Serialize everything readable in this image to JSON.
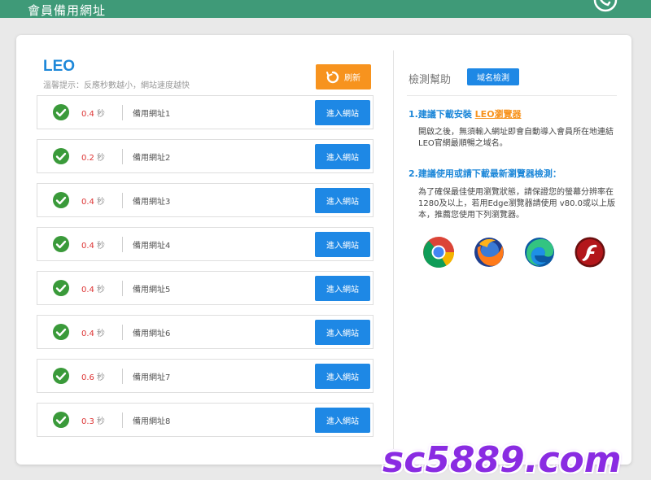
{
  "topbar": {
    "title": "會員備用網址"
  },
  "left": {
    "brand": "LEO",
    "hint": "溫馨提示：反應秒數越小，網站速度越快",
    "refresh_label": "刷新",
    "sites": [
      {
        "speed": "0.4",
        "unit": "秒",
        "name": "備用網址1",
        "button": "進入網站"
      },
      {
        "speed": "0.2",
        "unit": "秒",
        "name": "備用網址2",
        "button": "進入網站"
      },
      {
        "speed": "0.4",
        "unit": "秒",
        "name": "備用網址3",
        "button": "進入網站"
      },
      {
        "speed": "0.4",
        "unit": "秒",
        "name": "備用網址4",
        "button": "進入網站"
      },
      {
        "speed": "0.4",
        "unit": "秒",
        "name": "備用網址5",
        "button": "進入網站"
      },
      {
        "speed": "0.4",
        "unit": "秒",
        "name": "備用網址6",
        "button": "進入網站"
      },
      {
        "speed": "0.6",
        "unit": "秒",
        "name": "備用網址7",
        "button": "進入網站"
      },
      {
        "speed": "0.3",
        "unit": "秒",
        "name": "備用網址8",
        "button": "進入網站"
      }
    ]
  },
  "right": {
    "title": "檢測幫助",
    "domain_button": "域名檢測",
    "section1_prefix": "1.建議下載安裝 ",
    "section1_link": "LEO瀏覽器",
    "section1_text": "開啟之後，無須輸入網址即會自動導入會員所在地連結LEO官網最順暢之域名。",
    "section2_head": "2.建議使用或請下載最新瀏覽器檢測：",
    "section2_text": "為了確保最佳使用瀏覽狀態，請保證您的螢幕分辨率在1280及以上，若用Edge瀏覽器請使用 v80.0或以上版本，推薦您使用下列瀏覽器。",
    "browsers": [
      "chrome-icon",
      "firefox-icon",
      "edge-icon",
      "flash-icon"
    ]
  },
  "watermark": "sc5889.com",
  "colors": {
    "topbar": "#3f9a78",
    "accent_blue": "#1e88e5",
    "accent_orange": "#f7931e",
    "speed_red": "#dd3333",
    "check_green": "#3a9a3a",
    "watermark_purple": "#8a2be2"
  }
}
